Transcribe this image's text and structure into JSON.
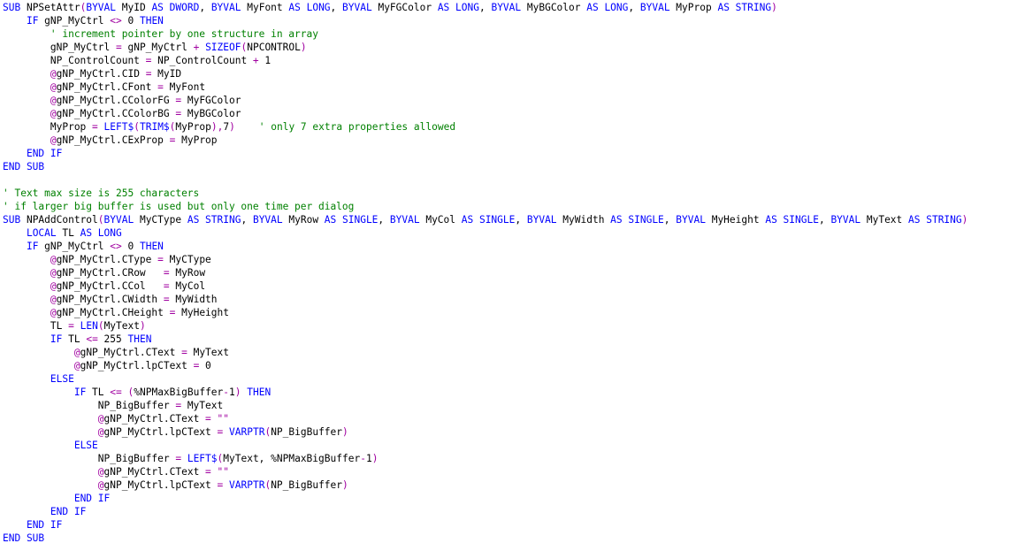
{
  "colors": {
    "background": "#ffffff",
    "text": "#000000",
    "keyword": "#0000ff",
    "operator": "#a000a0",
    "comment": "#008000"
  },
  "lines": [
    [
      [
        "kw",
        "SUB"
      ],
      [
        "t",
        " NPSetAttr"
      ],
      [
        "op",
        "("
      ],
      [
        "kw",
        "BYVAL"
      ],
      [
        "t",
        " MyID "
      ],
      [
        "kw",
        "AS DWORD"
      ],
      [
        "t",
        ", "
      ],
      [
        "kw",
        "BYVAL"
      ],
      [
        "t",
        " MyFont "
      ],
      [
        "kw",
        "AS LONG"
      ],
      [
        "t",
        ", "
      ],
      [
        "kw",
        "BYVAL"
      ],
      [
        "t",
        " MyFGColor "
      ],
      [
        "kw",
        "AS LONG"
      ],
      [
        "t",
        ", "
      ],
      [
        "kw",
        "BYVAL"
      ],
      [
        "t",
        " MyBGColor "
      ],
      [
        "kw",
        "AS LONG"
      ],
      [
        "t",
        ", "
      ],
      [
        "kw",
        "BYVAL"
      ],
      [
        "t",
        " MyProp "
      ],
      [
        "kw",
        "AS STRING"
      ],
      [
        "op",
        ")"
      ]
    ],
    [
      [
        "t",
        "    "
      ],
      [
        "kw",
        "IF"
      ],
      [
        "t",
        " gNP_MyCtrl "
      ],
      [
        "op",
        "<>"
      ],
      [
        "t",
        " 0 "
      ],
      [
        "kw",
        "THEN"
      ]
    ],
    [
      [
        "t",
        "        "
      ],
      [
        "cm",
        "' increment pointer by one structure in array"
      ]
    ],
    [
      [
        "t",
        "        gNP_MyCtrl "
      ],
      [
        "op",
        "="
      ],
      [
        "t",
        " gNP_MyCtrl "
      ],
      [
        "op",
        "+"
      ],
      [
        "t",
        " "
      ],
      [
        "kw",
        "SIZEOF"
      ],
      [
        "op",
        "("
      ],
      [
        "t",
        "NPCONTROL"
      ],
      [
        "op",
        ")"
      ]
    ],
    [
      [
        "t",
        "        NP_ControlCount "
      ],
      [
        "op",
        "="
      ],
      [
        "t",
        " NP_ControlCount "
      ],
      [
        "op",
        "+"
      ],
      [
        "t",
        " 1"
      ]
    ],
    [
      [
        "t",
        "        "
      ],
      [
        "at",
        "@"
      ],
      [
        "t",
        "gNP_MyCtrl.CID "
      ],
      [
        "op",
        "="
      ],
      [
        "t",
        " MyID"
      ]
    ],
    [
      [
        "t",
        "        "
      ],
      [
        "at",
        "@"
      ],
      [
        "t",
        "gNP_MyCtrl.CFont "
      ],
      [
        "op",
        "="
      ],
      [
        "t",
        " MyFont"
      ]
    ],
    [
      [
        "t",
        "        "
      ],
      [
        "at",
        "@"
      ],
      [
        "t",
        "gNP_MyCtrl.CColorFG "
      ],
      [
        "op",
        "="
      ],
      [
        "t",
        " MyFGColor"
      ]
    ],
    [
      [
        "t",
        "        "
      ],
      [
        "at",
        "@"
      ],
      [
        "t",
        "gNP_MyCtrl.CColorBG "
      ],
      [
        "op",
        "="
      ],
      [
        "t",
        " MyBGColor"
      ]
    ],
    [
      [
        "t",
        "        MyProp "
      ],
      [
        "op",
        "="
      ],
      [
        "t",
        " "
      ],
      [
        "kw",
        "LEFT$"
      ],
      [
        "op",
        "("
      ],
      [
        "kw",
        "TRIM$"
      ],
      [
        "op",
        "("
      ],
      [
        "t",
        "MyProp"
      ],
      [
        "op",
        "),"
      ],
      [
        "t",
        "7"
      ],
      [
        "op",
        ")"
      ],
      [
        "t",
        "    "
      ],
      [
        "cm",
        "' only 7 extra properties allowed"
      ]
    ],
    [
      [
        "t",
        "        "
      ],
      [
        "at",
        "@"
      ],
      [
        "t",
        "gNP_MyCtrl.CExProp "
      ],
      [
        "op",
        "="
      ],
      [
        "t",
        " MyProp"
      ]
    ],
    [
      [
        "t",
        "    "
      ],
      [
        "kw",
        "END IF"
      ]
    ],
    [
      [
        "kw",
        "END SUB"
      ]
    ],
    [],
    [
      [
        "cm",
        "' Text max size is 255 characters"
      ]
    ],
    [
      [
        "cm",
        "' if larger big buffer is used but only one time per dialog"
      ]
    ],
    [
      [
        "kw",
        "SUB"
      ],
      [
        "t",
        " NPAddControl"
      ],
      [
        "op",
        "("
      ],
      [
        "kw",
        "BYVAL"
      ],
      [
        "t",
        " MyCType "
      ],
      [
        "kw",
        "AS STRING"
      ],
      [
        "t",
        ", "
      ],
      [
        "kw",
        "BYVAL"
      ],
      [
        "t",
        " MyRow "
      ],
      [
        "kw",
        "AS SINGLE"
      ],
      [
        "t",
        ", "
      ],
      [
        "kw",
        "BYVAL"
      ],
      [
        "t",
        " MyCol "
      ],
      [
        "kw",
        "AS SINGLE"
      ],
      [
        "t",
        ", "
      ],
      [
        "kw",
        "BYVAL"
      ],
      [
        "t",
        " MyWidth "
      ],
      [
        "kw",
        "AS SINGLE"
      ],
      [
        "t",
        ", "
      ],
      [
        "kw",
        "BYVAL"
      ],
      [
        "t",
        " MyHeight "
      ],
      [
        "kw",
        "AS SINGLE"
      ],
      [
        "t",
        ", "
      ],
      [
        "kw",
        "BYVAL"
      ],
      [
        "t",
        " MyText "
      ],
      [
        "kw",
        "AS STRING"
      ],
      [
        "op",
        ")"
      ]
    ],
    [
      [
        "t",
        "    "
      ],
      [
        "kw",
        "LOCAL"
      ],
      [
        "t",
        " TL "
      ],
      [
        "kw",
        "AS LONG"
      ]
    ],
    [
      [
        "t",
        "    "
      ],
      [
        "kw",
        "IF"
      ],
      [
        "t",
        " gNP_MyCtrl "
      ],
      [
        "op",
        "<>"
      ],
      [
        "t",
        " 0 "
      ],
      [
        "kw",
        "THEN"
      ]
    ],
    [
      [
        "t",
        "        "
      ],
      [
        "at",
        "@"
      ],
      [
        "t",
        "gNP_MyCtrl.CType "
      ],
      [
        "op",
        "="
      ],
      [
        "t",
        " MyCType"
      ]
    ],
    [
      [
        "t",
        "        "
      ],
      [
        "at",
        "@"
      ],
      [
        "t",
        "gNP_MyCtrl.CRow   "
      ],
      [
        "op",
        "="
      ],
      [
        "t",
        " MyRow"
      ]
    ],
    [
      [
        "t",
        "        "
      ],
      [
        "at",
        "@"
      ],
      [
        "t",
        "gNP_MyCtrl.CCol   "
      ],
      [
        "op",
        "="
      ],
      [
        "t",
        " MyCol"
      ]
    ],
    [
      [
        "t",
        "        "
      ],
      [
        "at",
        "@"
      ],
      [
        "t",
        "gNP_MyCtrl.CWidth "
      ],
      [
        "op",
        "="
      ],
      [
        "t",
        " MyWidth"
      ]
    ],
    [
      [
        "t",
        "        "
      ],
      [
        "at",
        "@"
      ],
      [
        "t",
        "gNP_MyCtrl.CHeight "
      ],
      [
        "op",
        "="
      ],
      [
        "t",
        " MyHeight"
      ]
    ],
    [
      [
        "t",
        "        TL "
      ],
      [
        "op",
        "="
      ],
      [
        "t",
        " "
      ],
      [
        "kw",
        "LEN"
      ],
      [
        "op",
        "("
      ],
      [
        "t",
        "MyText"
      ],
      [
        "op",
        ")"
      ]
    ],
    [
      [
        "t",
        "        "
      ],
      [
        "kw",
        "IF"
      ],
      [
        "t",
        " TL "
      ],
      [
        "op",
        "<="
      ],
      [
        "t",
        " 255 "
      ],
      [
        "kw",
        "THEN"
      ]
    ],
    [
      [
        "t",
        "            "
      ],
      [
        "at",
        "@"
      ],
      [
        "t",
        "gNP_MyCtrl.CText "
      ],
      [
        "op",
        "="
      ],
      [
        "t",
        " MyText"
      ]
    ],
    [
      [
        "t",
        "            "
      ],
      [
        "at",
        "@"
      ],
      [
        "t",
        "gNP_MyCtrl.lpCText "
      ],
      [
        "op",
        "="
      ],
      [
        "t",
        " 0"
      ]
    ],
    [
      [
        "t",
        "        "
      ],
      [
        "kw",
        "ELSE"
      ]
    ],
    [
      [
        "t",
        "            "
      ],
      [
        "kw",
        "IF"
      ],
      [
        "t",
        " TL "
      ],
      [
        "op",
        "<="
      ],
      [
        "t",
        " "
      ],
      [
        "op",
        "("
      ],
      [
        "t",
        "%NPMaxBigBuffer"
      ],
      [
        "op",
        "-"
      ],
      [
        "t",
        "1"
      ],
      [
        "op",
        ")"
      ],
      [
        "t",
        " "
      ],
      [
        "kw",
        "THEN"
      ]
    ],
    [
      [
        "t",
        "                NP_BigBuffer "
      ],
      [
        "op",
        "="
      ],
      [
        "t",
        " MyText"
      ]
    ],
    [
      [
        "t",
        "                "
      ],
      [
        "at",
        "@"
      ],
      [
        "t",
        "gNP_MyCtrl.CText "
      ],
      [
        "op",
        "="
      ],
      [
        "t",
        " "
      ],
      [
        "op",
        "\"\""
      ]
    ],
    [
      [
        "t",
        "                "
      ],
      [
        "at",
        "@"
      ],
      [
        "t",
        "gNP_MyCtrl.lpCText "
      ],
      [
        "op",
        "="
      ],
      [
        "t",
        " "
      ],
      [
        "kw",
        "VARPTR"
      ],
      [
        "op",
        "("
      ],
      [
        "t",
        "NP_BigBuffer"
      ],
      [
        "op",
        ")"
      ]
    ],
    [
      [
        "t",
        "            "
      ],
      [
        "kw",
        "ELSE"
      ]
    ],
    [
      [
        "t",
        "                NP_BigBuffer "
      ],
      [
        "op",
        "="
      ],
      [
        "t",
        " "
      ],
      [
        "kw",
        "LEFT$"
      ],
      [
        "op",
        "("
      ],
      [
        "t",
        "MyText, %NPMaxBigBuffer"
      ],
      [
        "op",
        "-"
      ],
      [
        "t",
        "1"
      ],
      [
        "op",
        ")"
      ]
    ],
    [
      [
        "t",
        "                "
      ],
      [
        "at",
        "@"
      ],
      [
        "t",
        "gNP_MyCtrl.CText "
      ],
      [
        "op",
        "="
      ],
      [
        "t",
        " "
      ],
      [
        "op",
        "\"\""
      ]
    ],
    [
      [
        "t",
        "                "
      ],
      [
        "at",
        "@"
      ],
      [
        "t",
        "gNP_MyCtrl.lpCText "
      ],
      [
        "op",
        "="
      ],
      [
        "t",
        " "
      ],
      [
        "kw",
        "VARPTR"
      ],
      [
        "op",
        "("
      ],
      [
        "t",
        "NP_BigBuffer"
      ],
      [
        "op",
        ")"
      ]
    ],
    [
      [
        "t",
        "            "
      ],
      [
        "kw",
        "END IF"
      ]
    ],
    [
      [
        "t",
        "        "
      ],
      [
        "kw",
        "END IF"
      ]
    ],
    [
      [
        "t",
        "    "
      ],
      [
        "kw",
        "END IF"
      ]
    ],
    [
      [
        "kw",
        "END SUB"
      ]
    ]
  ]
}
